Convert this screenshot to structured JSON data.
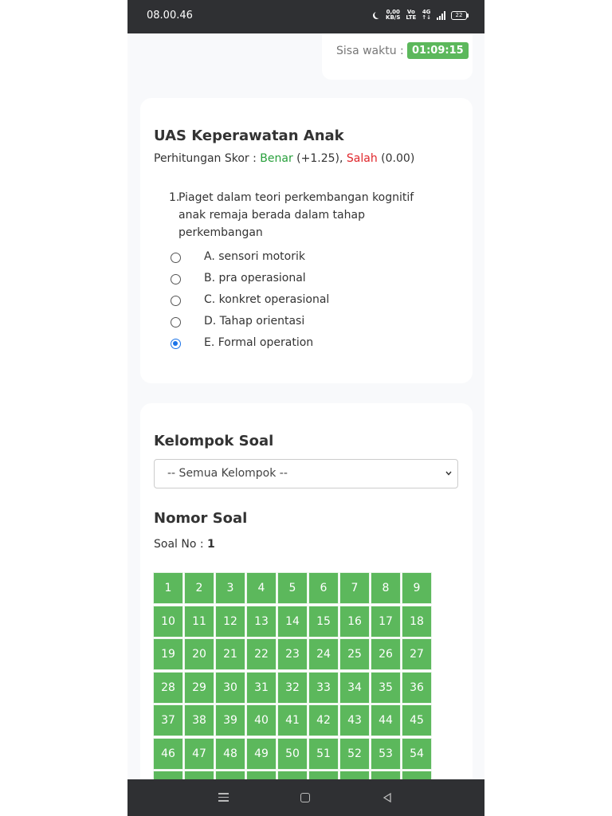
{
  "status_bar": {
    "time": "08.00.46",
    "speed_value": "0,00",
    "speed_unit": "KB/S",
    "volte": "Vo",
    "lte": "LTE",
    "network": "4G",
    "battery": "22"
  },
  "timer": {
    "label": "Sisa waktu :",
    "value": "01:09:15"
  },
  "exam": {
    "title": "UAS Keperawatan Anak",
    "score_prefix": "Perhitungan Skor : ",
    "correct_label": "Benar",
    "correct_value": " (+1.25), ",
    "wrong_label": "Salah",
    "wrong_value": " (0.00)",
    "colors": {
      "correct": "#28a03c",
      "wrong": "#e0262b",
      "selected": "#1a73e8"
    }
  },
  "question": {
    "number": "1.",
    "text": "Piaget dalam teori perkembangan kognitif anak remaja berada dalam tahap perkembangan",
    "options": [
      {
        "label": "A. sensori motorik",
        "selected": false
      },
      {
        "label": "B. pra operasional",
        "selected": false
      },
      {
        "label": "C. konkret operasional",
        "selected": false
      },
      {
        "label": "D. Tahap orientasi",
        "selected": false
      },
      {
        "label": "E. Formal operation",
        "selected": true
      }
    ]
  },
  "navigation": {
    "group_title": "Kelompok Soal",
    "group_selected": "-- Semua Kelompok --",
    "number_title": "Nomor Soal",
    "current_label": "Soal No : ",
    "current_value": "1",
    "grid_color": "#5cb85c",
    "numbers": [
      "1",
      "2",
      "3",
      "4",
      "5",
      "6",
      "7",
      "8",
      "9",
      "10",
      "11",
      "12",
      "13",
      "14",
      "15",
      "16",
      "17",
      "18",
      "19",
      "20",
      "21",
      "22",
      "23",
      "24",
      "25",
      "26",
      "27",
      "28",
      "29",
      "30",
      "31",
      "32",
      "33",
      "34",
      "35",
      "36",
      "37",
      "38",
      "39",
      "40",
      "41",
      "42",
      "43",
      "44",
      "45",
      "46",
      "47",
      "48",
      "49",
      "50",
      "51",
      "52",
      "53",
      "54",
      "",
      "",
      "",
      "",
      "",
      "",
      "",
      "",
      ""
    ]
  }
}
